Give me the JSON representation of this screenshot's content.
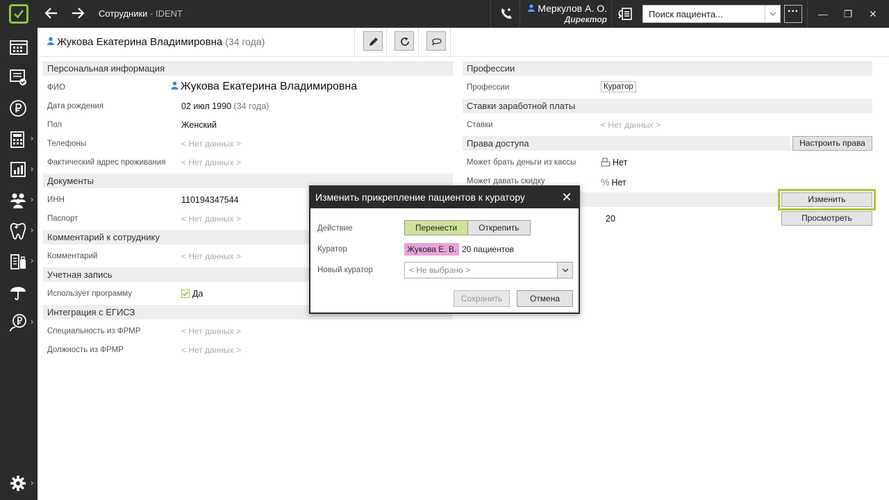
{
  "titlebar": {
    "title": "Сотрудники",
    "title_suffix": " - IDENT",
    "user_name": "Меркулов А. О.",
    "user_role": "Директор",
    "search_placeholder": "Поиск пациента...",
    "more_label": "···",
    "minimize": "—",
    "restore": "❐",
    "close": "✕"
  },
  "sidebar": {
    "items": [
      {
        "icon": "schedule-grid-icon"
      },
      {
        "icon": "monitor-check-icon"
      },
      {
        "icon": "ruble-icon"
      },
      {
        "icon": "calculator-icon"
      },
      {
        "icon": "reports-chart-icon"
      },
      {
        "icon": "people-icon"
      },
      {
        "icon": "tooth-icon"
      },
      {
        "icon": "inventory-icon"
      },
      {
        "icon": "umbrella-icon"
      },
      {
        "icon": "ruble-person-icon"
      },
      {
        "icon": "gear-icon"
      }
    ]
  },
  "header": {
    "name": "Жукова Екатерина Владимировна",
    "age": "(34 года)"
  },
  "left": {
    "personal": {
      "title": "Персональная информация",
      "fio_label": "ФИО",
      "fio_value": "Жукова Екатерина Владимировна",
      "dob_label": "Дата рождения",
      "dob_value": "02 июл 1990",
      "dob_age": "(34 года)",
      "sex_label": "Пол",
      "sex_value": "Женский",
      "phones_label": "Телефоны",
      "phones_value": "< Нет данных >",
      "address_label": "Фактический адрес проживания",
      "address_value": "< Нет данных >"
    },
    "documents": {
      "title": "Документы",
      "inn_label": "ИНН",
      "inn_value": "110194347544",
      "passport_label": "Паспорт",
      "passport_value": "< Нет данных >"
    },
    "comment": {
      "title": "Комментарий к сотруднику",
      "label": "Комментарий",
      "value": "< Нет данных >"
    },
    "account": {
      "title": "Учетная запись",
      "label": "Использует программу",
      "value": "Да"
    },
    "egisz": {
      "title": "Интеграция с ЕГИСЗ",
      "spec_label": "Специальность из ФРМР",
      "spec_value": "< Нет данных >",
      "pos_label": "Должность из ФРМР",
      "pos_value": "< Нет данных >"
    }
  },
  "right": {
    "professions": {
      "title": "Профессии",
      "label": "Профессии",
      "value": "Куратор"
    },
    "rates": {
      "title": "Ставки заработной платы",
      "label": "Ставки",
      "value": "< Нет данных >"
    },
    "access": {
      "title": "Права доступа",
      "configure_btn": "Настроить права",
      "cash_label": "Может брать деньги из кассы",
      "cash_value": "Нет",
      "discount_label": "Может давать скидку",
      "discount_value": "Нет"
    },
    "patients": {
      "change_btn": "Изменить",
      "view_btn": "Просмотреть",
      "count": "20"
    }
  },
  "modal": {
    "title": "Изменить прикрепление пациентов к куратору",
    "close": "✕",
    "action_label": "Действие",
    "action_move": "Перенести",
    "action_detach": "Открепить",
    "curator_label": "Куратор",
    "curator_value": "Жукова Е. В.",
    "curator_count": "20 пациентов",
    "new_curator_label": "Новый куратор",
    "new_curator_placeholder": "< Не выбрано >",
    "save_btn": "Сохранить",
    "cancel_btn": "Отмена"
  },
  "colors": {
    "accent": "#8dc63f",
    "dark": "#2b2b2b",
    "curator_tag": "#e8a4d8",
    "segment_active": "#cfe29a"
  }
}
